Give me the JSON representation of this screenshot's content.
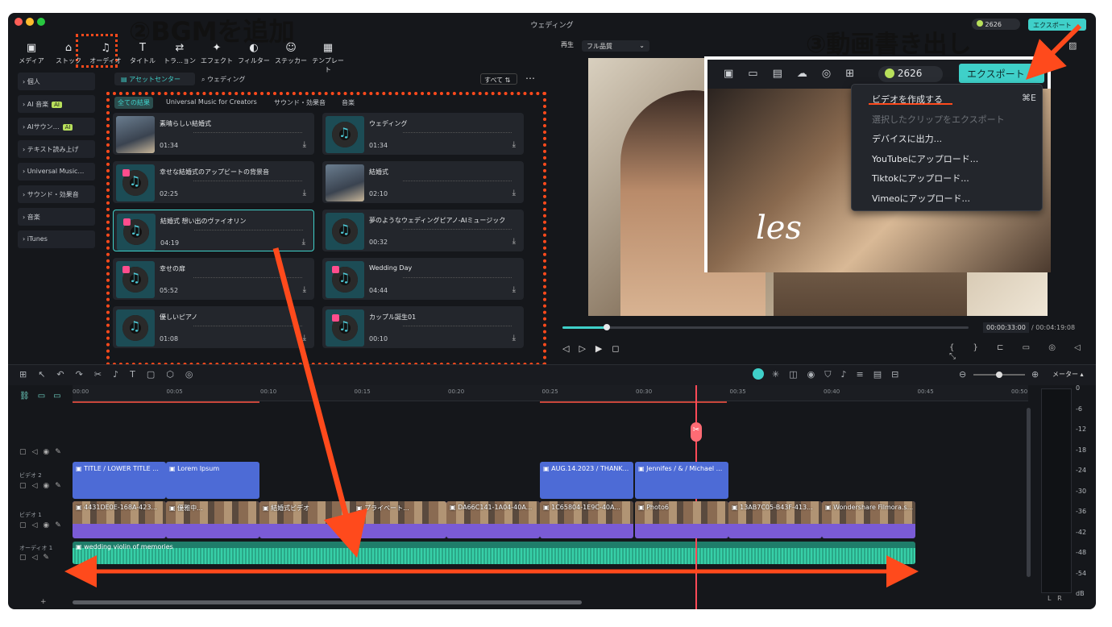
{
  "window": {
    "title": "ウェディング"
  },
  "toolbar": {
    "tools": [
      {
        "label": "メディア",
        "icon": "media-icon"
      },
      {
        "label": "ストック",
        "icon": "stock-icon"
      },
      {
        "label": "オーディオ",
        "icon": "audio-icon"
      },
      {
        "label": "タイトル",
        "icon": "title-icon"
      },
      {
        "label": "トラ…ョン",
        "icon": "transition-icon"
      },
      {
        "label": "エフェクト",
        "icon": "effect-icon"
      },
      {
        "label": "フィルター",
        "icon": "filter-icon"
      },
      {
        "label": "ステッカー",
        "icon": "sticker-icon"
      },
      {
        "label": "テンプレート",
        "icon": "template-icon"
      }
    ]
  },
  "sidebar": {
    "items": [
      {
        "label": "個人"
      },
      {
        "label": "AI 音楽",
        "badge": "AI"
      },
      {
        "label": "AIサウン…",
        "badge": "AI"
      },
      {
        "label": "テキスト読み上げ"
      },
      {
        "label": "Universal Music…"
      },
      {
        "label": "サウンド・効果音"
      },
      {
        "label": "音楽"
      },
      {
        "label": "iTunes"
      }
    ]
  },
  "asset": {
    "center_tab": "アセットセンター",
    "search_value": "ウェディング",
    "filter_all": "すべて",
    "chips": [
      "全ての結果",
      "Universal Music for Creators",
      "サウンド・効果音",
      "音楽"
    ]
  },
  "cards": [
    {
      "title": "素晴らしい結婚式",
      "duration": "01:34",
      "kind": "photo"
    },
    {
      "title": "ウェディング",
      "duration": "01:34",
      "kind": "disc"
    },
    {
      "title": "幸せな結婚式のアップビートの背景音",
      "duration": "02:25",
      "kind": "disc",
      "premium": true
    },
    {
      "title": "結婚式",
      "duration": "02:10",
      "kind": "photo"
    },
    {
      "title": "結婚式 想い出のヴァイオリン",
      "duration": "04:19",
      "kind": "disc",
      "premium": true
    },
    {
      "title": "夢のようなウェディングピアノ-AIミュージック",
      "duration": "00:32",
      "kind": "disc"
    },
    {
      "title": "幸せの扉",
      "duration": "05:52",
      "kind": "disc",
      "premium": true
    },
    {
      "title": "Wedding Day",
      "duration": "04:44",
      "kind": "disc",
      "premium": true
    },
    {
      "title": "優しいピアノ",
      "duration": "01:08",
      "kind": "disc"
    },
    {
      "title": "カップル誕生01",
      "duration": "00:10",
      "kind": "disc",
      "premium": true
    }
  ],
  "player": {
    "label": "再生",
    "quality": "フル品質",
    "current": "00:00:33:00",
    "total": "/ 00:04:19:08",
    "progress": 0.11
  },
  "export": {
    "credits": "2626",
    "button": "エクスポート",
    "menu": [
      {
        "label": "ビデオを作成する",
        "shortcut": "⌘E",
        "enabled": true
      },
      {
        "label": "選択したクリップをエクスポート",
        "enabled": false
      },
      {
        "label": "デバイスに出力...",
        "enabled": true
      },
      {
        "label": "YouTubeにアップロード...",
        "enabled": true
      },
      {
        "label": "Tiktokにアップロード...",
        "enabled": true
      },
      {
        "label": "Vimeoにアップロード...",
        "enabled": true
      }
    ]
  },
  "preview": {
    "overlay_text": "les"
  },
  "timeline": {
    "meter_label": "メーター",
    "ruler": [
      "00:00",
      "00:05",
      "00:10",
      "00:15",
      "00:20",
      "00:25",
      "00:30",
      "00:35",
      "00:40",
      "00:45",
      "00:50"
    ],
    "tracks": {
      "video2": "ビデオ 2",
      "video1": "ビデオ 1",
      "audio1": "オーディオ 1"
    },
    "title_clips": [
      "TITLE / LOWER TITLE ...",
      "Lorem Ipsum",
      "AUG.14.2023 / THANK...",
      "Jennifes / & / Michael ..."
    ],
    "video_clips": [
      "4431DE0E-168A-423...",
      "優雅中...",
      "結婚式ビデオ",
      "プライベート...",
      "DA66C141-1A04-40A...",
      "1C65804-1E9C-40A...",
      "Photo6",
      "13AB7C05-B43F-413...",
      "Wondershare Filmora.s..."
    ],
    "audio_clip": "wedding violin of memories",
    "db_scale": [
      "0",
      "-6",
      "-12",
      "-18",
      "-24",
      "-30",
      "-36",
      "-42",
      "-48",
      "-54",
      "dB"
    ],
    "lr": "L   R"
  },
  "annotations": {
    "step2": "②BGMを追加",
    "step3": "③動画書き出し"
  },
  "colors": {
    "accent": "#3fd0c9",
    "annotation": "#ff4a1c",
    "title_clip": "#4d6bd6",
    "video_clip": "#7a5bd6",
    "audio_clip": "#2fb89a"
  }
}
